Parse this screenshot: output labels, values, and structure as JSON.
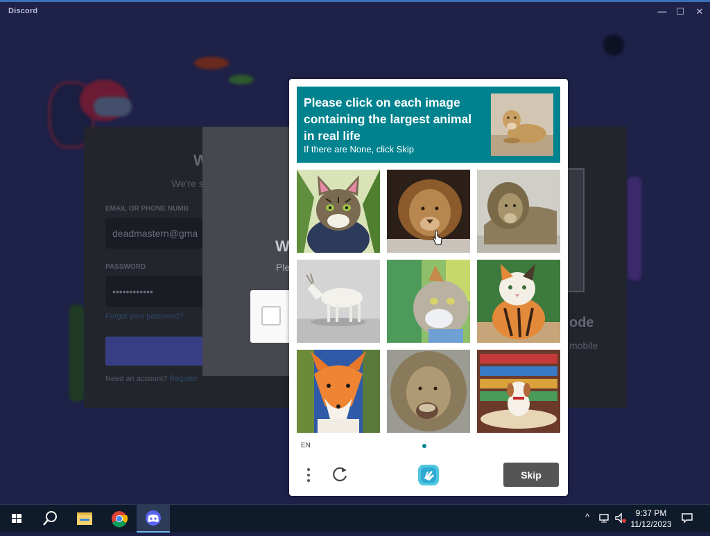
{
  "window": {
    "title": "Discord",
    "minimize_glyph": "—",
    "maximize_glyph": "☐",
    "close_glyph": "✕"
  },
  "login_background": {
    "heading_partial": "W",
    "subheading_partial": "We're s",
    "email_label": "EMAIL OR PHONE NUMB",
    "email_value": "deadmastern@gma",
    "password_label": "PASSWORD",
    "password_value": "••••••••••••",
    "forgot_link": "Forgot your password?",
    "register_text": "Need an account?",
    "register_link": "Register",
    "qr_title": "ode",
    "qr_subtitle": "mobile"
  },
  "welcome_modal": {
    "title_partial": "W",
    "subtitle_partial": "Ple"
  },
  "captcha": {
    "prompt_main": "Please click on each image containing the largest animal in real life",
    "prompt_sub": "If there are None, click Skip",
    "example_image": "lioness-lying",
    "tiles": [
      {
        "subject": "tabby-cat-painting"
      },
      {
        "subject": "lion-portrait"
      },
      {
        "subject": "lion-resting"
      },
      {
        "subject": "white-goat"
      },
      {
        "subject": "cat-watercolor"
      },
      {
        "subject": "calico-cat-painting"
      },
      {
        "subject": "fox-painting"
      },
      {
        "subject": "lion-closeup"
      },
      {
        "subject": "dog-in-library"
      }
    ],
    "language": "EN",
    "skip_label": "Skip",
    "accent_color": "#00838f"
  },
  "taskbar": {
    "apps": [
      "start-icon",
      "search-icon",
      "file-explorer-icon",
      "chrome-icon",
      "discord-icon"
    ],
    "time": "9:37 PM",
    "date": "11/12/2023"
  }
}
